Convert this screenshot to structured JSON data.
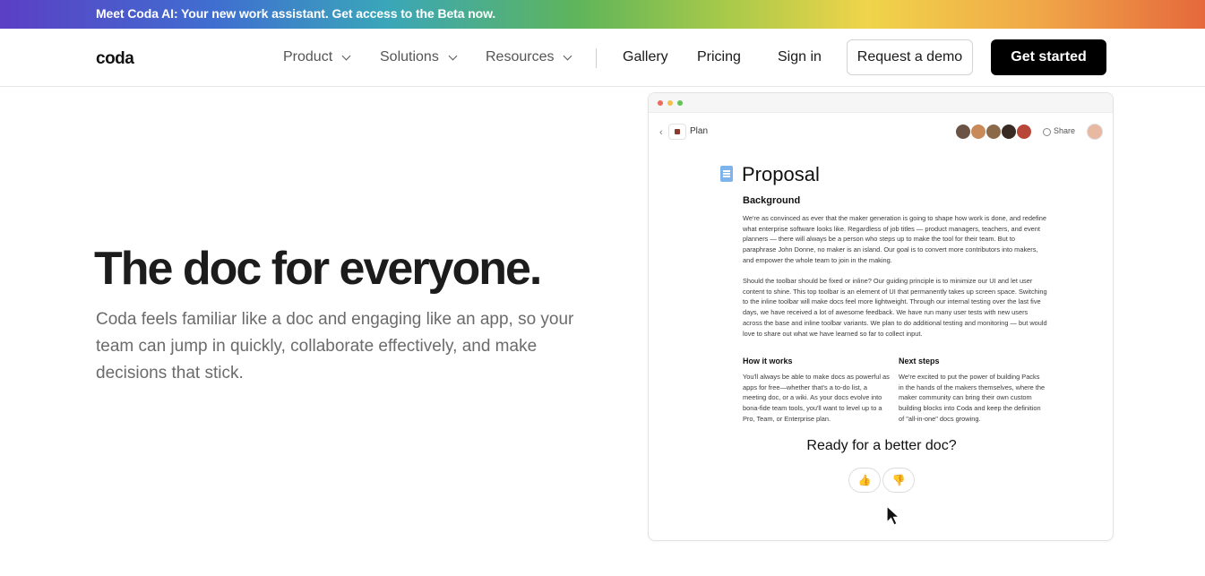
{
  "banner": {
    "text": "Meet Coda AI: Your new work assistant. Get access to the Beta now."
  },
  "nav": {
    "logo": "coda",
    "menus": [
      {
        "label": "Product",
        "icon": "chevron-down-icon"
      },
      {
        "label": "Solutions",
        "icon": "chevron-down-icon"
      },
      {
        "label": "Resources",
        "icon": "chevron-down-icon"
      }
    ],
    "links": {
      "gallery": "Gallery",
      "pricing": "Pricing",
      "signin": "Sign in"
    },
    "demo_button": "Request a demo",
    "start_button": "Get started"
  },
  "hero": {
    "title": "The doc for everyone.",
    "subtitle": "Coda feels familiar like a doc and engaging like an app, so your team can jump in quickly, collaborate effectively, and make decisions that stick."
  },
  "doc": {
    "back": "‹",
    "page_name": "Plan",
    "share": "Share",
    "title": "Proposal",
    "background_heading": "Background",
    "paragraph1": "We're as convinced as ever that the maker generation is going to shape how work is done, and redefine what enterprise software looks like. Regardless of job titles — product managers, teachers, and event planners — there will always be a person who steps up to make the tool for their team. But to paraphrase John Donne, no maker is an island. Our goal is to convert more contributors into makers, and empower the whole team to join in the making.",
    "paragraph2": "Should the toolbar should be fixed or inline? Our guiding principle is to minimize our UI and let user content to shine. This top toolbar is an element of UI that permanently takes up screen space. Switching to the inline toolbar will make docs feel more lightweight. Through our internal testing over the last five days, we have received a lot of awesome feedback. We have run many user tests with new users across the base and inline toolbar variants. We plan to do additional testing and monitoring — but would love to share out what we have learned so far to collect input.",
    "how_heading": "How it works",
    "how_text": "You'll always be able to make docs as powerful as apps for free—whether that's a to-do list, a meeting doc, or a wiki. As your docs evolve into bona-fide team tools, you'll want to level up to a Pro, Team, or Enterprise plan.",
    "next_heading": "Next steps",
    "next_text": "We're excited to put the power of building Packs in the hands of the makers themselves, where the maker community can bring their own custom building blocks into Coda and keep the definition of \"all-in-one\" docs growing.",
    "ready": "Ready for a better doc?",
    "thumbs_up": "👍",
    "thumbs_down": "👎"
  },
  "colors": {
    "window_dots": [
      "#ec6a5e",
      "#f4bf4f",
      "#61c554"
    ],
    "avatars": [
      "#6b5445",
      "#c98a5a",
      "#8b6a4a",
      "#3a2a24",
      "#b8473a"
    ]
  }
}
